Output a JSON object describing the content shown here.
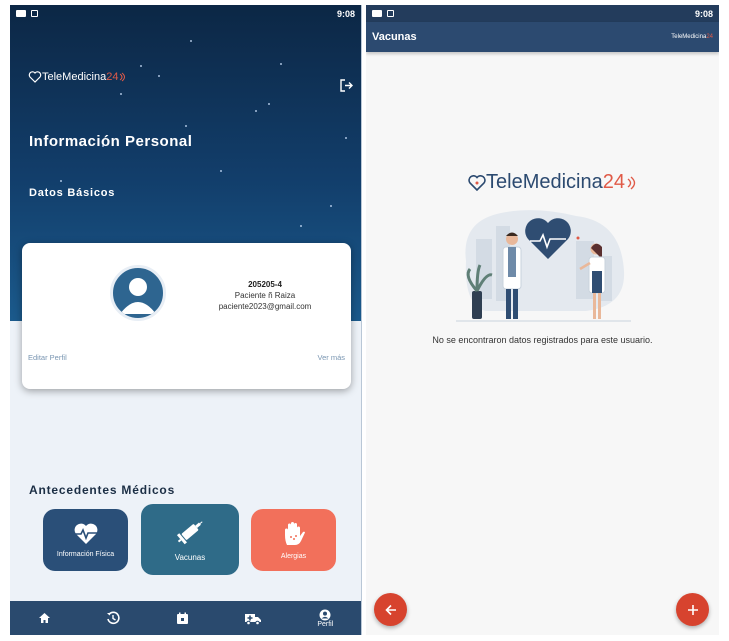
{
  "status": {
    "time": "9:08"
  },
  "brand": {
    "part1": "TeleMedicina",
    "part2": "24"
  },
  "profile": {
    "title": "Información Personal",
    "section": "Datos Básicos",
    "card": {
      "id": "205205-4",
      "name": "Paciente ñ Raiza",
      "email": "paciente2023@gmail.com",
      "edit_label": "Editar Perfil",
      "more_label": "Ver más"
    },
    "antecedentes_title": "Antecedentes Médicos",
    "tiles": [
      {
        "label": "Información Física",
        "icon": "heart-pulse-icon"
      },
      {
        "label": "Vacunas",
        "icon": "syringe-icon"
      },
      {
        "label": "Alergias",
        "icon": "allergy-hand-icon"
      }
    ],
    "nav": [
      {
        "icon": "home-icon",
        "label": ""
      },
      {
        "icon": "history-icon",
        "label": ""
      },
      {
        "icon": "calendar-icon",
        "label": ""
      },
      {
        "icon": "ambulance-icon",
        "label": ""
      },
      {
        "icon": "user-icon",
        "label": "Perfil"
      }
    ]
  },
  "vacunas": {
    "title": "Vacunas",
    "empty_message": "No se encontraron datos registrados para este usuario."
  },
  "colors": {
    "primary": "#2c4a70",
    "accent": "#d7432e",
    "allergy": "#f2705b",
    "vaccine": "#2f6b88"
  }
}
